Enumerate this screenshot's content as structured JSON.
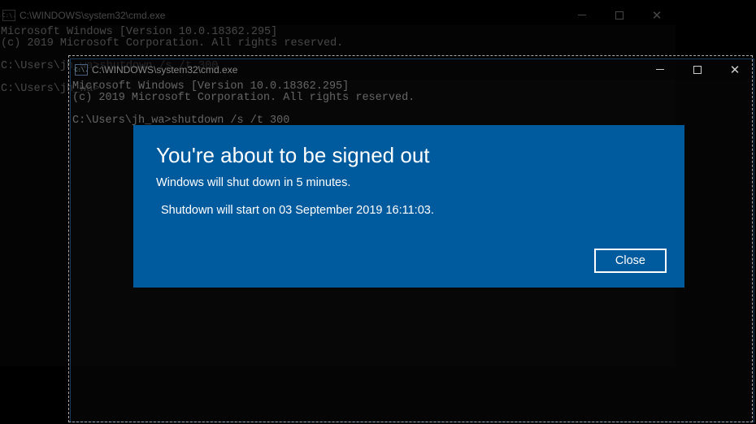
{
  "cmd1": {
    "icon_label": "C:\\.",
    "title": "C:\\WINDOWS\\system32\\cmd.exe",
    "lines": {
      "l1": "Microsoft Windows [Version 10.0.18362.295]",
      "l2": "(c) 2019 Microsoft Corporation. All rights reserved.",
      "l3": "",
      "l4": "C:\\Users\\jh_wa>shutdown /s /t 300",
      "l5": "",
      "l6": "C:\\Users\\jh_wa>"
    }
  },
  "cmd2": {
    "icon_label": "C:\\.",
    "title": "C:\\WINDOWS\\system32\\cmd.exe",
    "lines": {
      "l1": "Microsoft Windows [Version 10.0.18362.295]",
      "l2": "(c) 2019 Microsoft Corporation. All rights reserved.",
      "l3": "",
      "l4": "C:\\Users\\jh_wa>shutdown /s /t 300"
    }
  },
  "dialog": {
    "title": "You're about to be signed out",
    "msg1": "Windows will shut down in 5 minutes.",
    "msg2": "Shutdown will start on 03 September 2019 16:11:03.",
    "close_label": "Close"
  }
}
